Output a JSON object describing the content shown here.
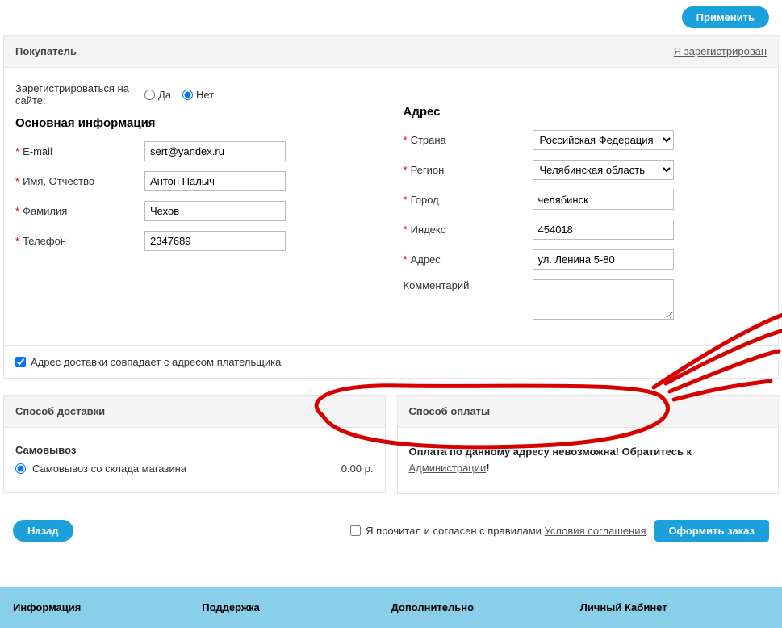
{
  "topButton": {
    "apply": "Применить"
  },
  "buyer": {
    "title": "Покупатель",
    "registeredLink": "Я зарегистрирован"
  },
  "registerOnSite": {
    "label": "Зарегистрироваться на сайте:",
    "yes": "Да",
    "no": "Нет"
  },
  "mainInfo": {
    "heading": "Основная информация",
    "fields": {
      "email": {
        "label": "E-mail",
        "value": "sert@yandex.ru"
      },
      "name": {
        "label": "Имя, Отчество",
        "value": "Антон Палыч"
      },
      "surname": {
        "label": "Фамилия",
        "value": "Чехов"
      },
      "phone": {
        "label": "Телефон",
        "value": "2347689"
      }
    }
  },
  "address": {
    "heading": "Адрес",
    "fields": {
      "country": {
        "label": "Страна",
        "value": "Российская Федерация"
      },
      "region": {
        "label": "Регион",
        "value": "Челябинская область"
      },
      "city": {
        "label": "Город",
        "value": "челябинск"
      },
      "index": {
        "label": "Индекс",
        "value": "454018"
      },
      "addr": {
        "label": "Адрес",
        "value": "ул. Ленина 5-80"
      },
      "comment": {
        "label": "Комментарий",
        "value": ""
      }
    }
  },
  "sameAddress": {
    "label": "Адрес доставки совпадает с адресом плательщика"
  },
  "delivery": {
    "header": "Способ доставки",
    "pickupTitle": "Самовывоз",
    "pickupOption": "Самовывоз со склада магазина",
    "price": "0.00 р."
  },
  "payment": {
    "header": "Способ оплаты",
    "msg1": "Оплата по данному адресу невозможна! Обратитесь к ",
    "adminLink": "Администрации",
    "msg2": "!"
  },
  "bottom": {
    "back": "Назад",
    "agree": "Я прочитал и согласен с правилами ",
    "termsLink": "Условия соглашения",
    "submit": "Оформить заказ"
  },
  "footer": {
    "col1": "Информация",
    "col2": "Поддержка",
    "col3": "Дополнительно",
    "col4": "Личный Кабинет"
  }
}
